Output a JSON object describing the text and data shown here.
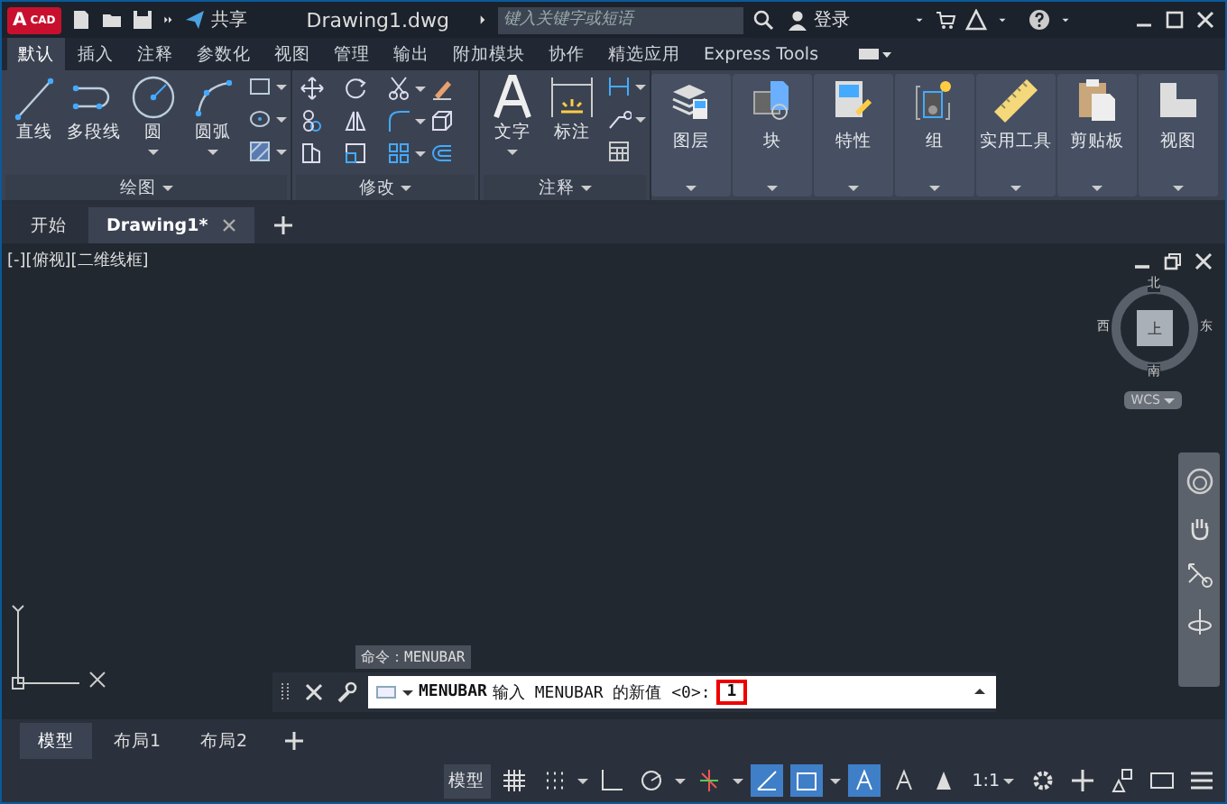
{
  "title_bar": {
    "app_badge": {
      "letter": "A",
      "label": "CAD"
    },
    "share": "共享",
    "file_name": "Drawing1.dwg",
    "search": {
      "placeholder": "键入关键字或短语"
    },
    "user": "登录"
  },
  "ribbon_tabs": [
    {
      "label": "默认",
      "selected": true
    },
    {
      "label": "插入",
      "selected": false
    },
    {
      "label": "注释",
      "selected": false
    },
    {
      "label": "参数化",
      "selected": false
    },
    {
      "label": "视图",
      "selected": false
    },
    {
      "label": "管理",
      "selected": false
    },
    {
      "label": "输出",
      "selected": false
    },
    {
      "label": "附加模块",
      "selected": false
    },
    {
      "label": "协作",
      "selected": false
    },
    {
      "label": "精选应用",
      "selected": false
    },
    {
      "label": "Express Tools",
      "selected": false
    }
  ],
  "draw_panel": {
    "title": "绘图",
    "tools": [
      {
        "label": "直线",
        "dropdown": false
      },
      {
        "label": "多段线",
        "dropdown": false
      },
      {
        "label": "圆",
        "dropdown": true
      },
      {
        "label": "圆弧",
        "dropdown": true
      }
    ]
  },
  "modify_panel": {
    "title": "修改"
  },
  "annotation_panel": {
    "title": "注释",
    "tools": [
      {
        "label": "文字",
        "dropdown": true
      },
      {
        "label": "标注",
        "dropdown": false
      }
    ]
  },
  "ribbon_buttons": [
    {
      "label": "图层"
    },
    {
      "label": "块"
    },
    {
      "label": "特性"
    },
    {
      "label": "组"
    },
    {
      "label": "实用工具"
    },
    {
      "label": "剪贴板"
    },
    {
      "label": "视图"
    }
  ],
  "file_tabs": [
    {
      "label": "开始",
      "selected": false,
      "closable": false
    },
    {
      "label": "Drawing1*",
      "selected": true,
      "closable": true
    }
  ],
  "viewport": {
    "label": "[-][俯视][二维线框]",
    "viewcube": {
      "top": "上",
      "north": "北",
      "east": "东",
      "south": "南",
      "west": "西",
      "ucs": "WCS"
    }
  },
  "command": {
    "history": "命令：MENUBAR",
    "name": "MENUBAR",
    "prompt": "输入 MENUBAR 的新值 <0>:",
    "value": "1"
  },
  "layout_tabs": [
    {
      "label": "模型",
      "selected": true
    },
    {
      "label": "布局1",
      "selected": false
    },
    {
      "label": "布局2",
      "selected": false
    }
  ],
  "status_bar": {
    "model": "模型",
    "scale": "1:1"
  }
}
